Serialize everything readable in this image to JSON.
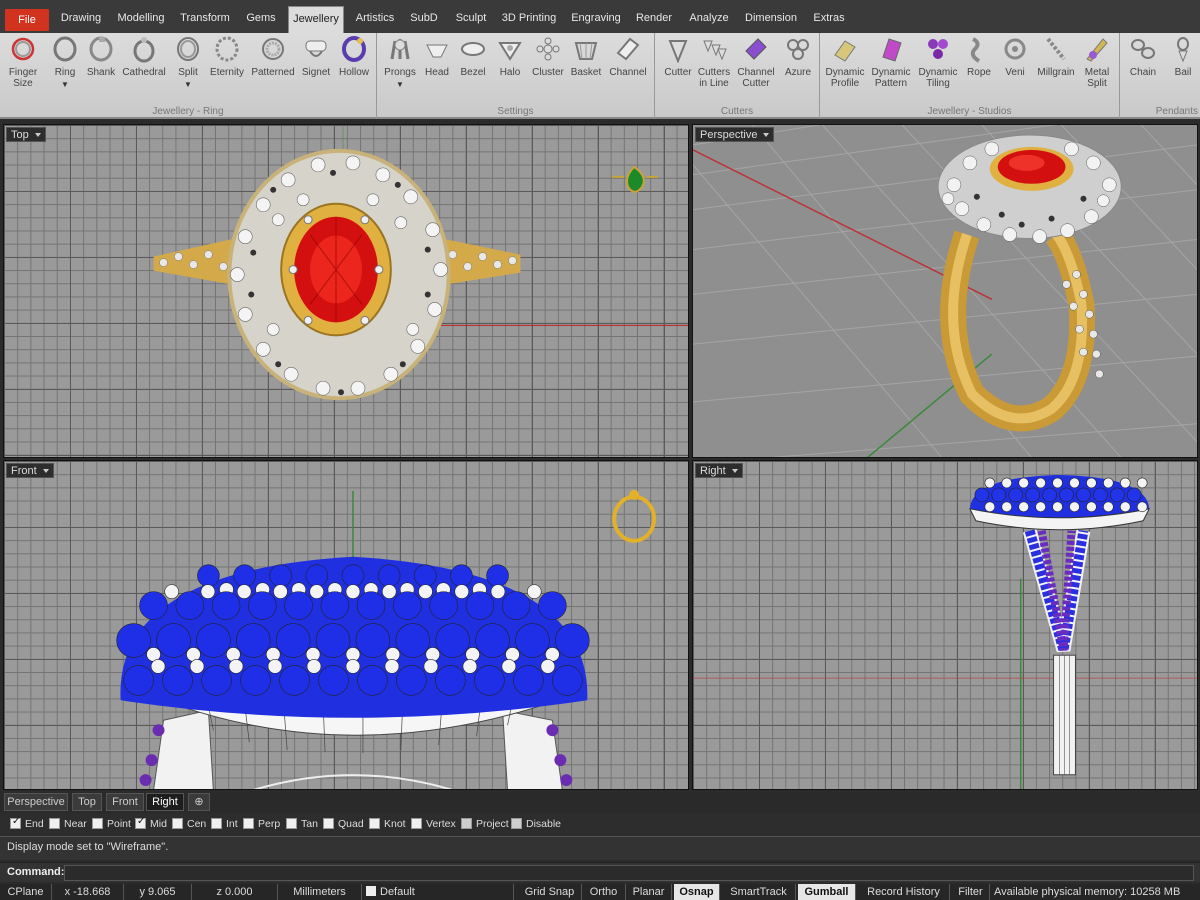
{
  "menu": {
    "tabs": [
      "File",
      "Drawing",
      "Modelling",
      "Transform",
      "Gems",
      "Jewellery",
      "Artistics",
      "SubD",
      "Sculpt",
      "3D Printing",
      "Engraving",
      "Render",
      "Analyze",
      "Dimension",
      "Extras"
    ],
    "active": "Jewellery"
  },
  "ribbon": {
    "groups": [
      {
        "label": "Jewellery - Ring",
        "tools": [
          "Finger\nSize",
          "Ring",
          "Shank",
          "Cathedral",
          "Split",
          "Eternity",
          "Patterned",
          "Signet",
          "Hollow"
        ]
      },
      {
        "label": "Settings",
        "tools": [
          "Prongs",
          "Head",
          "Bezel",
          "Halo",
          "Cluster",
          "Basket",
          "Channel"
        ]
      },
      {
        "label": "Cutters",
        "tools": [
          "Cutter",
          "Cutters\nin Line",
          "Channel\nCutter",
          "Azure"
        ]
      },
      {
        "label": "Jewellery - Studios",
        "tools": [
          "Dynamic\nProfile",
          "Dynamic\nPattern",
          "Dynamic\nTiling",
          "Rope",
          "Veni",
          "Millgrain",
          "Metal\nSplit"
        ]
      },
      {
        "label": "Pendants",
        "tools": [
          "Chain",
          "Bail"
        ]
      }
    ]
  },
  "viewports": {
    "top": "Top",
    "perspective": "Perspective",
    "front": "Front",
    "right": "Right"
  },
  "viewport_tabs": [
    "Perspective",
    "Top",
    "Front",
    "Right"
  ],
  "osnap": [
    {
      "label": "End",
      "checked": true
    },
    {
      "label": "Near",
      "checked": false
    },
    {
      "label": "Point",
      "checked": false
    },
    {
      "label": "Mid",
      "checked": true
    },
    {
      "label": "Cen",
      "checked": false
    },
    {
      "label": "Int",
      "checked": false
    },
    {
      "label": "Perp",
      "checked": false
    },
    {
      "label": "Tan",
      "checked": false
    },
    {
      "label": "Quad",
      "checked": false
    },
    {
      "label": "Knot",
      "checked": false
    },
    {
      "label": "Vertex",
      "checked": false
    },
    {
      "label": "Project",
      "checked": false
    },
    {
      "label": "Disable",
      "checked": false
    }
  ],
  "command": {
    "history": "Display mode set to \"Wireframe\".",
    "prompt": "Command:",
    "value": ""
  },
  "status": {
    "cplane": "CPlane",
    "x": "x -18.668",
    "y": "y 9.065",
    "z": "z 0.000",
    "units": "Millimeters",
    "layer": "Default",
    "grid_snap": "Grid Snap",
    "ortho": "Ortho",
    "planar": "Planar",
    "osnap": "Osnap",
    "smarttrack": "SmartTrack",
    "gumball": "Gumball",
    "record_history": "Record History",
    "filter": "Filter",
    "memory": "Available physical memory: 10258 MB"
  },
  "colors": {
    "file_tab": "#d2331f",
    "gold": "#d9a53a",
    "ruby": "#d40f0f",
    "sapphire": "#1822d8",
    "emerald": "#1d8a2a"
  }
}
